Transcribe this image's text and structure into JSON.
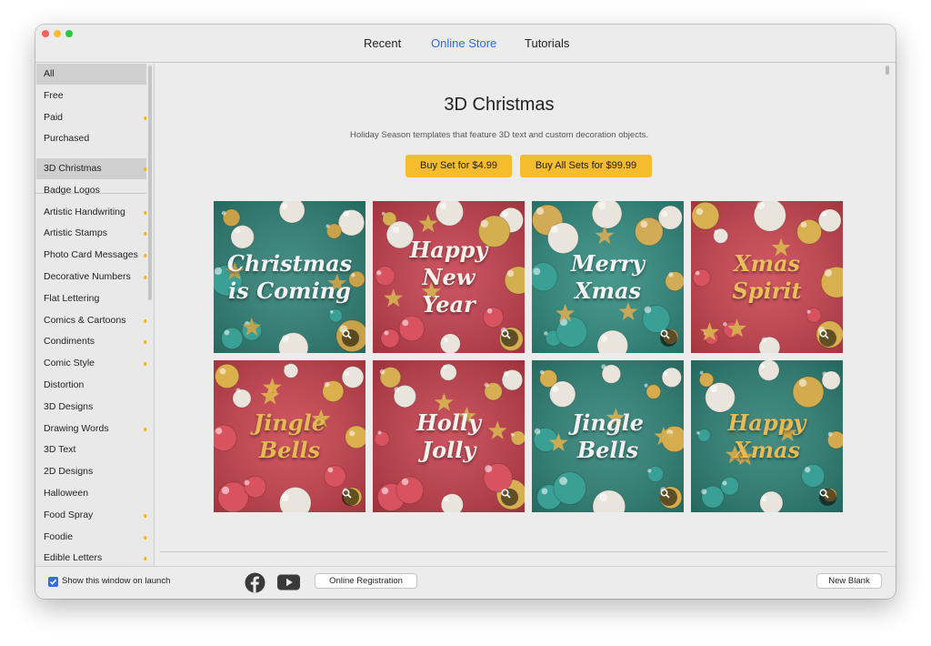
{
  "window": {
    "tabs": [
      {
        "label": "Recent",
        "active": false
      },
      {
        "label": "Online Store",
        "active": true
      },
      {
        "label": "Tutorials",
        "active": false
      }
    ]
  },
  "sidebar": {
    "filters": [
      {
        "label": "All",
        "selected": true,
        "paid": false
      },
      {
        "label": "Free",
        "selected": false,
        "paid": false
      },
      {
        "label": "Paid",
        "selected": false,
        "paid": true
      },
      {
        "label": "Purchased",
        "selected": false,
        "paid": false
      }
    ],
    "categories": [
      {
        "label": "3D Christmas",
        "selected": true,
        "paid": true
      },
      {
        "label": "Badge Logos",
        "selected": false,
        "paid": false
      },
      {
        "label": "Artistic Handwriting",
        "selected": false,
        "paid": true
      },
      {
        "label": "Artistic Stamps",
        "selected": false,
        "paid": true
      },
      {
        "label": "Photo Card Messages",
        "selected": false,
        "paid": true
      },
      {
        "label": "Decorative Numbers",
        "selected": false,
        "paid": true
      },
      {
        "label": "Flat Lettering",
        "selected": false,
        "paid": false
      },
      {
        "label": "Comics & Cartoons",
        "selected": false,
        "paid": true
      },
      {
        "label": "Condiments",
        "selected": false,
        "paid": true
      },
      {
        "label": "Comic Style",
        "selected": false,
        "paid": true
      },
      {
        "label": "Distortion",
        "selected": false,
        "paid": false
      },
      {
        "label": "3D Designs",
        "selected": false,
        "paid": false
      },
      {
        "label": "Drawing Words",
        "selected": false,
        "paid": true
      },
      {
        "label": "3D Text",
        "selected": false,
        "paid": false
      },
      {
        "label": "2D Designs",
        "selected": false,
        "paid": false
      },
      {
        "label": "Halloween",
        "selected": false,
        "paid": false
      },
      {
        "label": "Food Spray",
        "selected": false,
        "paid": true
      },
      {
        "label": "Foodie",
        "selected": false,
        "paid": true
      },
      {
        "label": "Edible Letters",
        "selected": false,
        "paid": true
      }
    ]
  },
  "store": {
    "title": "3D Christmas",
    "description": "Holiday Season templates that feature 3D text and custom decoration objects.",
    "buy_set_label": "Buy Set for $4.99",
    "buy_all_label": "Buy All Sets for $99.99",
    "templates": [
      {
        "text": "Christmas\nis Coming",
        "bg": "#2d7f75",
        "text_color": "#f2f2f2",
        "ornament_color": "#c8a24a"
      },
      {
        "text": "Happy\nNew\nYear",
        "bg": "#c43e4c",
        "text_color": "#f6f1ea",
        "ornament_color": "#d4af50"
      },
      {
        "text": "Merry\nXmas",
        "bg": "#2f8a7e",
        "text_color": "#f4f4f4",
        "ornament_color": "#d1ab56"
      },
      {
        "text": "Xmas\nSpirit",
        "bg": "#c9414d",
        "text_color": "#e8bf5a",
        "ornament_color": "#d9b050"
      },
      {
        "text": "Jingle\nBells",
        "bg": "#c8404c",
        "text_color": "#e5b954",
        "ornament_color": "#dcb14d"
      },
      {
        "text": "Holly\nJolly",
        "bg": "#c23c49",
        "text_color": "#f4f2ef",
        "ornament_color": "#d7ae52"
      },
      {
        "text": "Jingle\nBells",
        "bg": "#2d8176",
        "text_color": "#f0f0f0",
        "ornament_color": "#d5ad4e"
      },
      {
        "text": "Happy\nXmas",
        "bg": "#2b7e73",
        "text_color": "#e6bb57",
        "ornament_color": "#d3aa4d"
      }
    ]
  },
  "footer": {
    "show_on_launch_label": "Show this window on launch",
    "show_on_launch_checked": true,
    "facebook_icon": "facebook-icon",
    "youtube_icon": "youtube-icon",
    "registration_label": "Online Registration",
    "new_blank_label": "New Blank"
  }
}
